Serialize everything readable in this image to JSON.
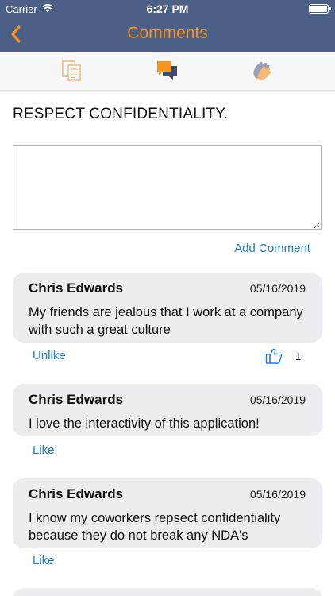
{
  "status_bar": {
    "carrier": "Carrier",
    "time": "6:27 PM"
  },
  "nav": {
    "title": "Comments"
  },
  "tabs": [
    {
      "name": "documents",
      "icon": "documents-icon"
    },
    {
      "name": "comments",
      "icon": "chat-bubbles-icon",
      "active": true
    },
    {
      "name": "applause",
      "icon": "clapping-hands-icon"
    }
  ],
  "topic": "RESPECT CONFIDENTIALITY.",
  "comment_box": {
    "value": ""
  },
  "add_comment_label": "Add Comment",
  "comments": [
    {
      "author": "Chris Edwards",
      "date": "05/16/2019",
      "text": "My friends are jealous that I work at a company with such a great culture",
      "action": "Unlike",
      "likes": "1"
    },
    {
      "author": "Chris Edwards",
      "date": "05/16/2019",
      "text": "I love the interactivity of this application!",
      "action": "Like"
    },
    {
      "author": "Chris Edwards",
      "date": "05/16/2019",
      "text": "I know my coworkers repsect confidentiality because they do not break any NDA's",
      "action": "Like"
    }
  ],
  "colors": {
    "nav_bg": "#4c5f86",
    "accent": "#f7941d",
    "link": "#1e7fd6",
    "card_bg": "#ececf1"
  }
}
